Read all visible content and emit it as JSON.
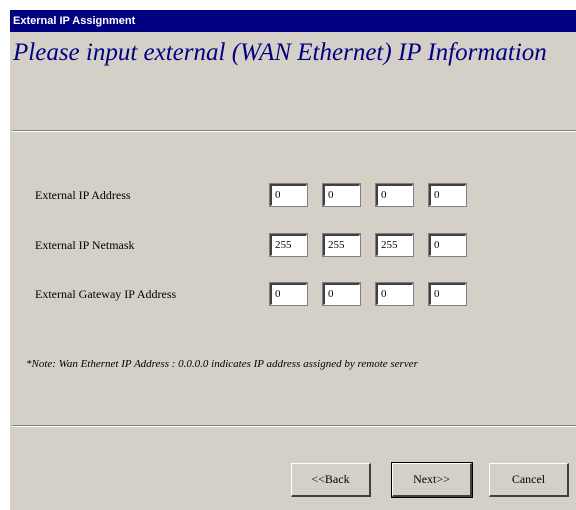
{
  "window": {
    "title": "External IP Assignment",
    "heading": "Please input external (WAN Ethernet) IP Information"
  },
  "fields": [
    {
      "label": "External IP Address",
      "octets": [
        "0",
        "0",
        "0",
        "0"
      ]
    },
    {
      "label": "External IP Netmask",
      "octets": [
        "255",
        "255",
        "255",
        "0"
      ]
    },
    {
      "label": "External Gateway IP Address",
      "octets": [
        "0",
        "0",
        "0",
        "0"
      ]
    }
  ],
  "note": "*Note: Wan Ethernet IP Address : 0.0.0.0 indicates IP address assigned by remote server",
  "buttons": {
    "back": "<<Back",
    "next": "Next>>",
    "cancel": "Cancel"
  },
  "colors": {
    "titlebar": "#000080",
    "heading": "#000080",
    "dialog_bg": "#d4d0c8"
  }
}
